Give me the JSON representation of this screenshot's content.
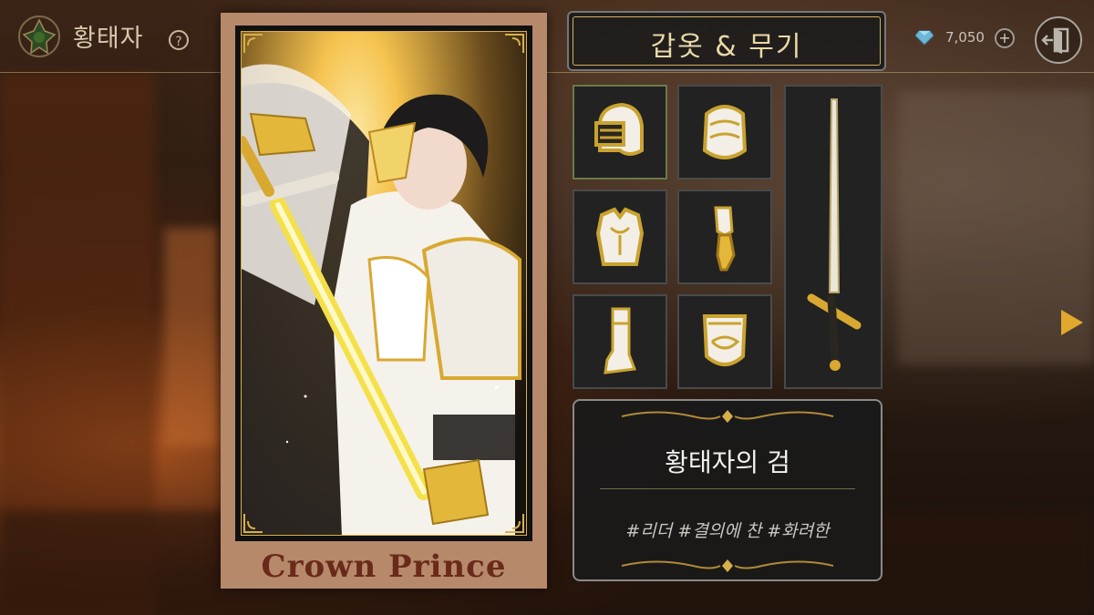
{
  "header": {
    "title": "황태자",
    "help_label": "?",
    "currency_value": "7,050",
    "plus_label": "+"
  },
  "card": {
    "name": "Crown Prince"
  },
  "panel": {
    "title": "갑옷 & 무기"
  },
  "equipment": [
    {
      "icon": "helmet-icon"
    },
    {
      "icon": "pauldron-icon"
    },
    {
      "icon": "breastplate-icon"
    },
    {
      "icon": "gauntlet-icon"
    },
    {
      "icon": "greave-icon"
    },
    {
      "icon": "shield-icon"
    },
    {
      "icon": "sword-icon"
    }
  ],
  "item": {
    "name": "황태자의 검",
    "tags": "#리더 #결의에 찬 #화려한"
  },
  "colors": {
    "gold": "#d8b04a",
    "panel_bg": "#222222",
    "card_frame": "#b7896b",
    "card_name": "#6a2a1a"
  }
}
